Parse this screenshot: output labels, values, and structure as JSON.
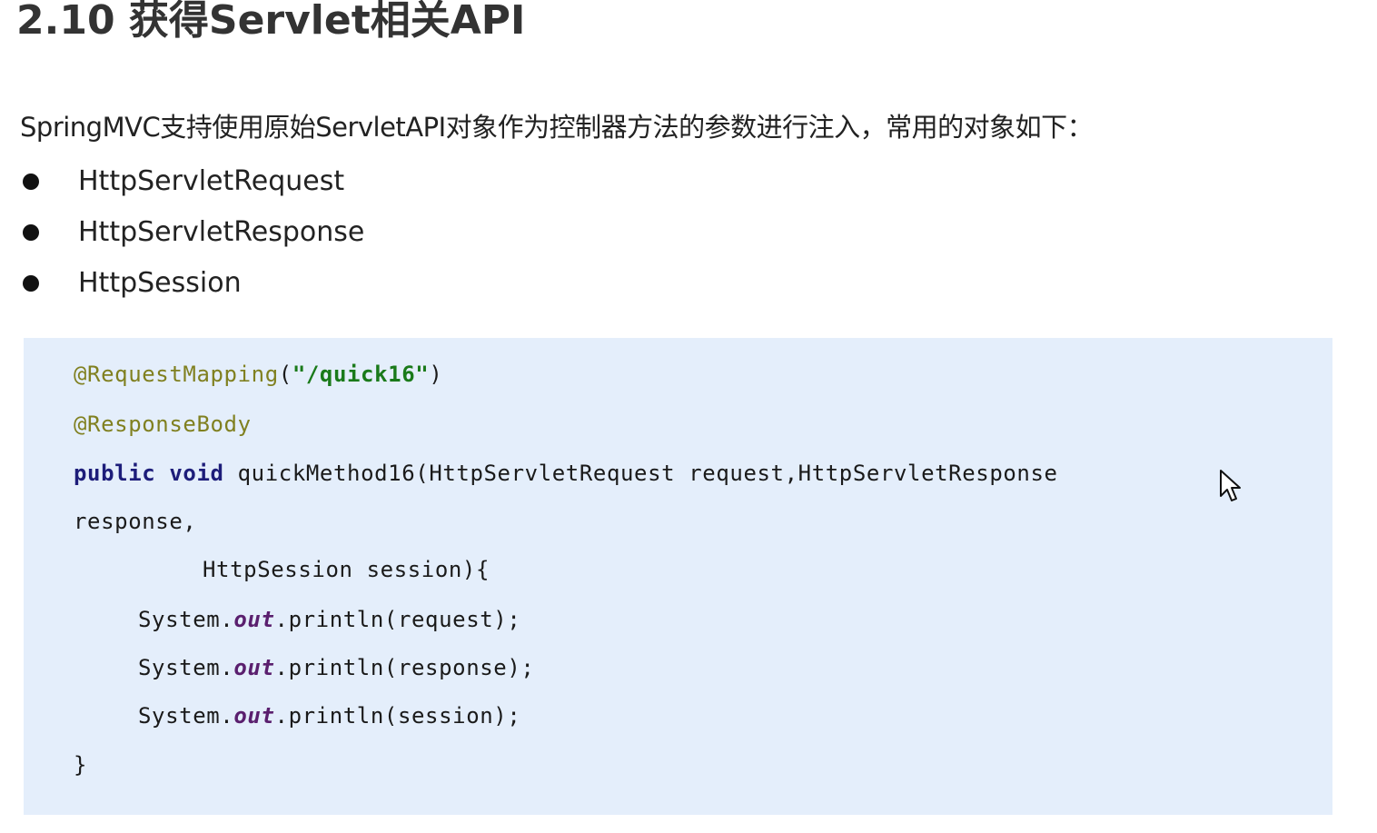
{
  "heading": {
    "title": "2.10 获得Servlet相关API"
  },
  "intro": {
    "text": "SpringMVC支持使用原始ServletAPI对象作为控制器方法的参数进行注入，常用的对象如下："
  },
  "bullets": [
    {
      "label": "HttpServletRequest"
    },
    {
      "label": "HttpServletResponse"
    },
    {
      "label": "HttpSession"
    }
  ],
  "code": {
    "l1_annotation": "@RequestMapping",
    "l1_open": "(",
    "l1_string": "\"/quick16\"",
    "l1_close": ")",
    "l2_annotation": "@ResponseBody",
    "l3_public": "public",
    "l3_void": "void",
    "l3_rest": "quickMethod16(HttpServletRequest request,HttpServletResponse",
    "l4": "response,",
    "l5": "HttpSession session){",
    "l6_prefix": "System.",
    "l6_field": "out",
    "l6_suffix": ".println(request);",
    "l7_prefix": "System.",
    "l7_field": "out",
    "l7_suffix": ".println(response);",
    "l8_prefix": "System.",
    "l8_field": "out",
    "l8_suffix": ".println(session);",
    "l9": "}"
  },
  "cursor": {
    "icon": "mouse-pointer-icon"
  }
}
